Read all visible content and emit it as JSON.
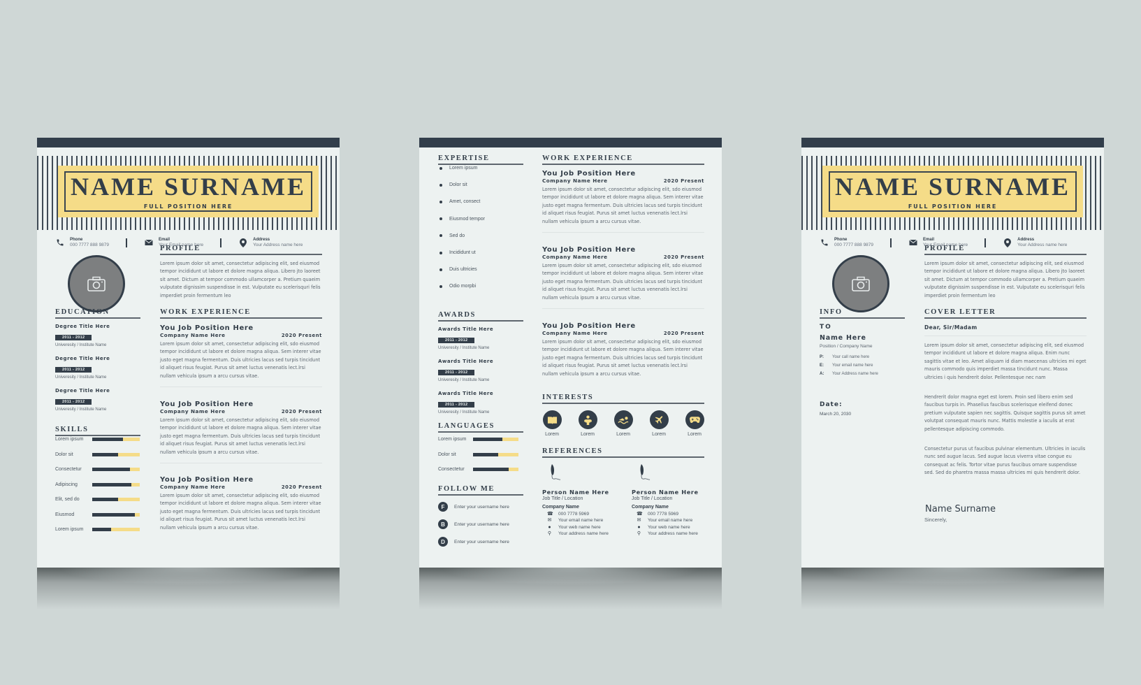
{
  "colors": {
    "dark": "#323e4b",
    "accent": "#f5dc88",
    "page": "#edf2f1",
    "background": "#cfd7d6",
    "photo": "#7d7f80"
  },
  "header": {
    "name": "NAME SURNAME",
    "position": "FULL POSITION HERE"
  },
  "contacts": [
    {
      "icon": "phone-icon",
      "label": "Phone",
      "value": "000 7777 888 9879"
    },
    {
      "icon": "envelope-icon",
      "label": "Email",
      "value": "Your Email name here"
    },
    {
      "icon": "map-pin-icon",
      "label": "Address",
      "value": "Your Address name here"
    }
  ],
  "sections": {
    "profile": "PROFILE",
    "education": "EDUCATION",
    "work_experience": "WORK EXPERIENCE",
    "skills": "SKILLS",
    "expertise": "EXPERTISE",
    "awards": "AWARDS",
    "languages": "LANGUAGES",
    "follow_me": "FOLLOW ME",
    "interests": "INTERESTS",
    "references": "REFERENCES",
    "info": "INFO",
    "cover_letter": "COVER LETTER"
  },
  "profile_text": "Lorem ipsum dolor sit amet, consectetur adipiscing elit, sed eiusmod tempor incididunt ut labore et dolore magna aliqua. Libero jto laoreet sit amet. Dictum at tempor commodo ullamcorper a. Pretium quaeim vulputate dignissim suspendisse in est. Vulputate eu scelerisquri felis imperdiet proin fermentum leo",
  "jobs": [
    {
      "title": "You Job Position Here",
      "company": "Company Name Here",
      "years": "2020 Present",
      "text": "Lorem ipsum dolor sit amet, consectetur adipiscing elit, sdo eiusmod tempor incididunt ut labore et dolore magna aliqua. Sem interer vitae justo eget magna fermentum. Duis ultricies lacus sed turpis tincidunt id aliquet risus feugiat. Purus sit amet luctus venenatis lect.lrsi nullam vehicula ipsum a arcu cursus vitae."
    },
    {
      "title": "You Job Position Here",
      "company": "Company Name Here",
      "years": "2020 Present",
      "text": "Lorem ipsum dolor sit amet, consectetur adipiscing elit, sdo eiusmod tempor incididunt ut labore et dolore magna aliqua. Sem interer vitae justo eget magna fermentum. Duis ultricies lacus sed turpis tincidunt id aliquet risus feugiat. Purus sit amet luctus venenatis lect.lrsi nullam vehicula ipsum a arcu cursus vitae."
    },
    {
      "title": "You Job Position Here",
      "company": "Company Name Here",
      "years": "2020 Present",
      "text": "Lorem ipsum dolor sit amet, consectetur adipiscing elit, sdo eiusmod tempor incididunt ut labore et dolore magna aliqua. Sem interer vitae justo eget magna fermentum. Duis ultricies lacus sed turpis tincidunt id aliquet risus feugiat. Purus sit amet luctus venenatis lect.lrsi nullam vehicula ipsum a arcu cursus vitae."
    }
  ],
  "education": [
    {
      "title": "Degree Title Here",
      "years": "2011 - 2012",
      "institute": "Univeresity / Institute Name"
    },
    {
      "title": "Degree Title Here",
      "years": "2011 - 2012",
      "institute": "Univeresity / Institute Name"
    },
    {
      "title": "Degree Title Here",
      "years": "2011 - 2012",
      "institute": "Univeresity / Institute Name"
    }
  ],
  "skills": [
    {
      "label": "Lorem ipsum",
      "level": 0.65
    },
    {
      "label": "Dolor sit",
      "level": 0.55
    },
    {
      "label": "Consectetur",
      "level": 0.8
    },
    {
      "label": "Adipiscing",
      "level": 0.82
    },
    {
      "label": "Elit, sed do",
      "level": 0.55
    },
    {
      "label": "Eiusmod",
      "level": 0.9
    },
    {
      "label": "Lorem ipsum",
      "level": 0.4
    }
  ],
  "expertise": [
    "Lorem ipsum",
    "Dolor sit",
    "Amet, consect",
    "Eiusmod tempor",
    "Sed do",
    "Incididunt ut",
    "Duis ultricies",
    "Odio morpbi"
  ],
  "awards": [
    {
      "title": "Awards Title Here",
      "years": "2011 - 2012",
      "institute": "Univeresity / Institute Name"
    },
    {
      "title": "Awards Title Here",
      "years": "2011 - 2012",
      "institute": "Univeresity / Institute Name"
    },
    {
      "title": "Awards Title Here",
      "years": "2011 - 2012",
      "institute": "Univeresity / Institute Name"
    }
  ],
  "languages": [
    {
      "label": "Lorem ipsum",
      "level": 0.65
    },
    {
      "label": "Dolor sit",
      "level": 0.55
    },
    {
      "label": "Consectetur",
      "level": 0.78
    }
  ],
  "follow": [
    {
      "letter": "F",
      "text": "Enter your username here"
    },
    {
      "letter": "B",
      "text": "Enter your username here"
    },
    {
      "letter": "D",
      "text": "Enter your username here"
    }
  ],
  "interests": [
    {
      "icon": "book-icon",
      "label": "Lorem"
    },
    {
      "icon": "person-icon",
      "label": "Lorem"
    },
    {
      "icon": "swimming-icon",
      "label": "Lorem"
    },
    {
      "icon": "airplane-icon",
      "label": "Lorem"
    },
    {
      "icon": "gamepad-icon",
      "label": "Lorem"
    }
  ],
  "references": [
    {
      "name": "Person Name Here",
      "job": "Job Title / Location",
      "company": "Company Name",
      "phone": "000 7778 5969",
      "email": "Your email name here",
      "web": "Your web name here",
      "address": "Your address name here"
    },
    {
      "name": "Person Name Here",
      "job": "Job Title / Location",
      "company": "Company Name",
      "phone": "000 7778 5969",
      "email": "Your email name here",
      "web": "Your web name here",
      "address": "Your address name here"
    }
  ],
  "info": {
    "to": "TO",
    "name": "Name Here",
    "position": "Position / Company Name",
    "lines": [
      {
        "key": "P:",
        "value": "Your  call name here"
      },
      {
        "key": "E:",
        "value": "Your  email name here"
      },
      {
        "key": "A:",
        "value": "Your  Address name here"
      }
    ],
    "date_label": "Date:",
    "date": "March 20, 2030"
  },
  "cover_letter": {
    "salutation": "Dear, Sir/Madam",
    "paragraphs": [
      "Lorem ipsum dolor sit amet, consectetur adipiscing elit, sed eiusmod tempor incididunt ut labore et dolore magna aliqua. Enim nunc sagittis vitae et leo. Amet aliquam id diam maecenas ultricies mi eget mauris commodo quis imperdiet massa tincidunt nunc. Massa ultricies i quis hendrerit dolor. Pellentesque nec nam",
      "Hendrerit dolor magna eget est lorem. Proin sed libero enim sed faucibus turpis in. Phasellus faucibus scelerisque eleifend donec pretium vulputate sapien nec sagittis. Quisque sagittis purus sit amet volutpat consequat mauris nunc. Mattis molestie a iaculis at erat pellentesque adipiscing commodo.",
      "Consectetur purus ut faucibus pulvinar elementum. Ultricies in iaculis nunc sed augue lacus. Sed augue lacus viverra vitae congue eu consequat ac felis. Tortor vitae purus faucibus ornare suspendisse sed. Sed do pharetra massa massa ultricies mi quis hendrerit dolor."
    ],
    "signature": "Name Surname",
    "closing": "Sincerely,"
  }
}
